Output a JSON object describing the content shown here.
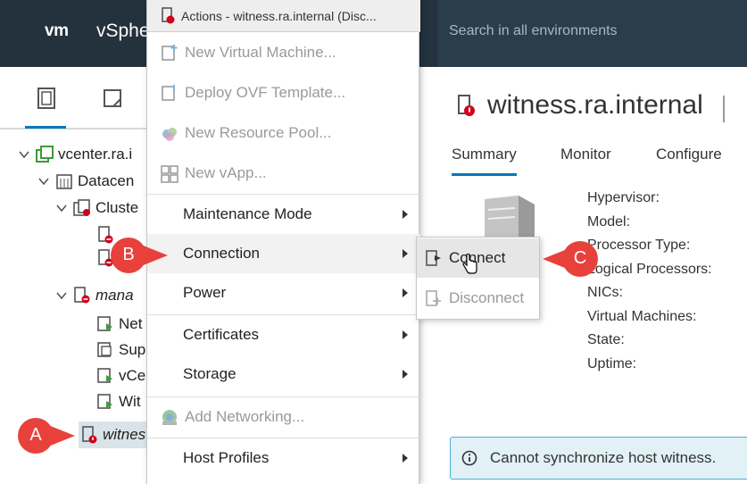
{
  "header": {
    "logo": "vm",
    "app_name": "vSphe",
    "search_placeholder": "Search in all environments"
  },
  "navigator": {
    "tabs": [
      {
        "icon": "hosts-and-clusters-icon"
      },
      {
        "icon": "vms-and-templates-icon"
      }
    ],
    "tree": [
      {
        "label": "vcenter.ra.i",
        "icon": "vcenter-icon"
      },
      {
        "label": "Datacen",
        "icon": "datacenter-icon"
      },
      {
        "label": "Cluste",
        "icon": "cluster-icon"
      },
      {
        "label": "",
        "icon": "host-error-icon"
      },
      {
        "label": "",
        "icon": "host-error-icon"
      },
      {
        "label": "mana",
        "icon": "vapp-error-icon"
      },
      {
        "label": "Net",
        "icon": "vm-icon"
      },
      {
        "label": "Sup",
        "icon": "vm-icon"
      },
      {
        "label": "vCe",
        "icon": "vm-icon"
      },
      {
        "label": "Wit",
        "icon": "vm-icon"
      },
      {
        "label": "witnes",
        "icon": "host-disconnected-icon"
      }
    ]
  },
  "actions_menu": {
    "title": "Actions - witness.ra.internal (Disc...",
    "items": [
      {
        "label": "New Virtual Machine...",
        "enabled": false,
        "icon": "new-vm-icon"
      },
      {
        "label": "Deploy OVF Template...",
        "enabled": false,
        "icon": "deploy-ovf-icon"
      },
      {
        "label": "New Resource Pool...",
        "enabled": false,
        "icon": "resource-pool-icon"
      },
      {
        "label": "New vApp...",
        "enabled": false,
        "icon": "vapp-icon"
      },
      {
        "label": "Maintenance Mode",
        "enabled": true,
        "submenu": true
      },
      {
        "label": "Connection",
        "enabled": true,
        "submenu": true
      },
      {
        "label": "Power",
        "enabled": true,
        "submenu": true
      },
      {
        "label": "Certificates",
        "enabled": true,
        "submenu": true
      },
      {
        "label": "Storage",
        "enabled": true,
        "submenu": true
      },
      {
        "label": "Add Networking...",
        "enabled": false,
        "icon": "add-networking-icon"
      },
      {
        "label": "Host Profiles",
        "enabled": true,
        "submenu": true
      }
    ]
  },
  "connection_submenu": {
    "items": [
      {
        "label": "Connect",
        "enabled": true,
        "icon": "connect-icon"
      },
      {
        "label": "Disconnect",
        "enabled": false,
        "icon": "disconnect-icon"
      }
    ]
  },
  "content": {
    "host_title": "witness.ra.internal",
    "tabs": [
      "Summary",
      "Monitor",
      "Configure"
    ],
    "active_tab": "Summary",
    "properties": [
      "Hypervisor:",
      "Model:",
      "Processor Type:",
      "Logical Processors:",
      "NICs:",
      "Virtual Machines:",
      "State:",
      "Uptime:"
    ],
    "alert_text": "Cannot synchronize host witness."
  },
  "callouts": [
    {
      "label": "A"
    },
    {
      "label": "B"
    },
    {
      "label": "C"
    }
  ],
  "colors": {
    "header_bg": "#24323e",
    "accent_blue": "#0079b8",
    "callout_red": "#e8413c",
    "alert_bg": "#e1f1f6"
  }
}
